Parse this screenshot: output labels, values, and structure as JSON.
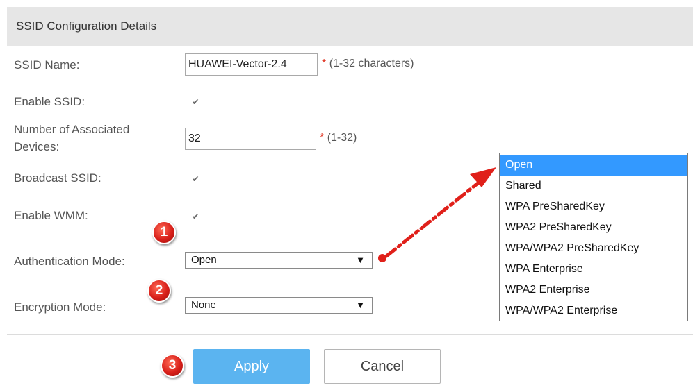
{
  "header": {
    "title": "SSID Configuration Details"
  },
  "fields": {
    "ssid_name": {
      "label": "SSID Name:",
      "value": "HUAWEI-Vector-2.4",
      "hint": "(1-32 characters)",
      "required": "*"
    },
    "enable_ssid": {
      "label": "Enable SSID:",
      "checked": true
    },
    "associated_devices": {
      "label_line1": "Number of Associated",
      "label_line2": "Devices:",
      "value": "32",
      "hint": "(1-32)",
      "required": "*"
    },
    "broadcast_ssid": {
      "label": "Broadcast SSID:",
      "checked": true
    },
    "enable_wmm": {
      "label": "Enable WMM:",
      "checked": true
    },
    "auth_mode": {
      "label": "Authentication Mode:",
      "value": "Open"
    },
    "encryption_mode": {
      "label": "Encryption Mode:",
      "value": "None"
    }
  },
  "dropdown_options": [
    "Open",
    "Shared",
    "WPA PreSharedKey",
    "WPA2 PreSharedKey",
    "WPA/WPA2 PreSharedKey",
    "WPA Enterprise",
    "WPA2 Enterprise",
    "WPA/WPA2 Enterprise"
  ],
  "dropdown_selected": "Open",
  "badges": {
    "b1": "1",
    "b2": "2",
    "b3": "3"
  },
  "buttons": {
    "apply": "Apply",
    "cancel": "Cancel"
  },
  "glyphs": {
    "check": "✔",
    "arrow": "▼"
  },
  "colors": {
    "accent_blue": "#5bb4f0",
    "highlight": "#3399ff",
    "annotation_red": "#e0201a"
  }
}
